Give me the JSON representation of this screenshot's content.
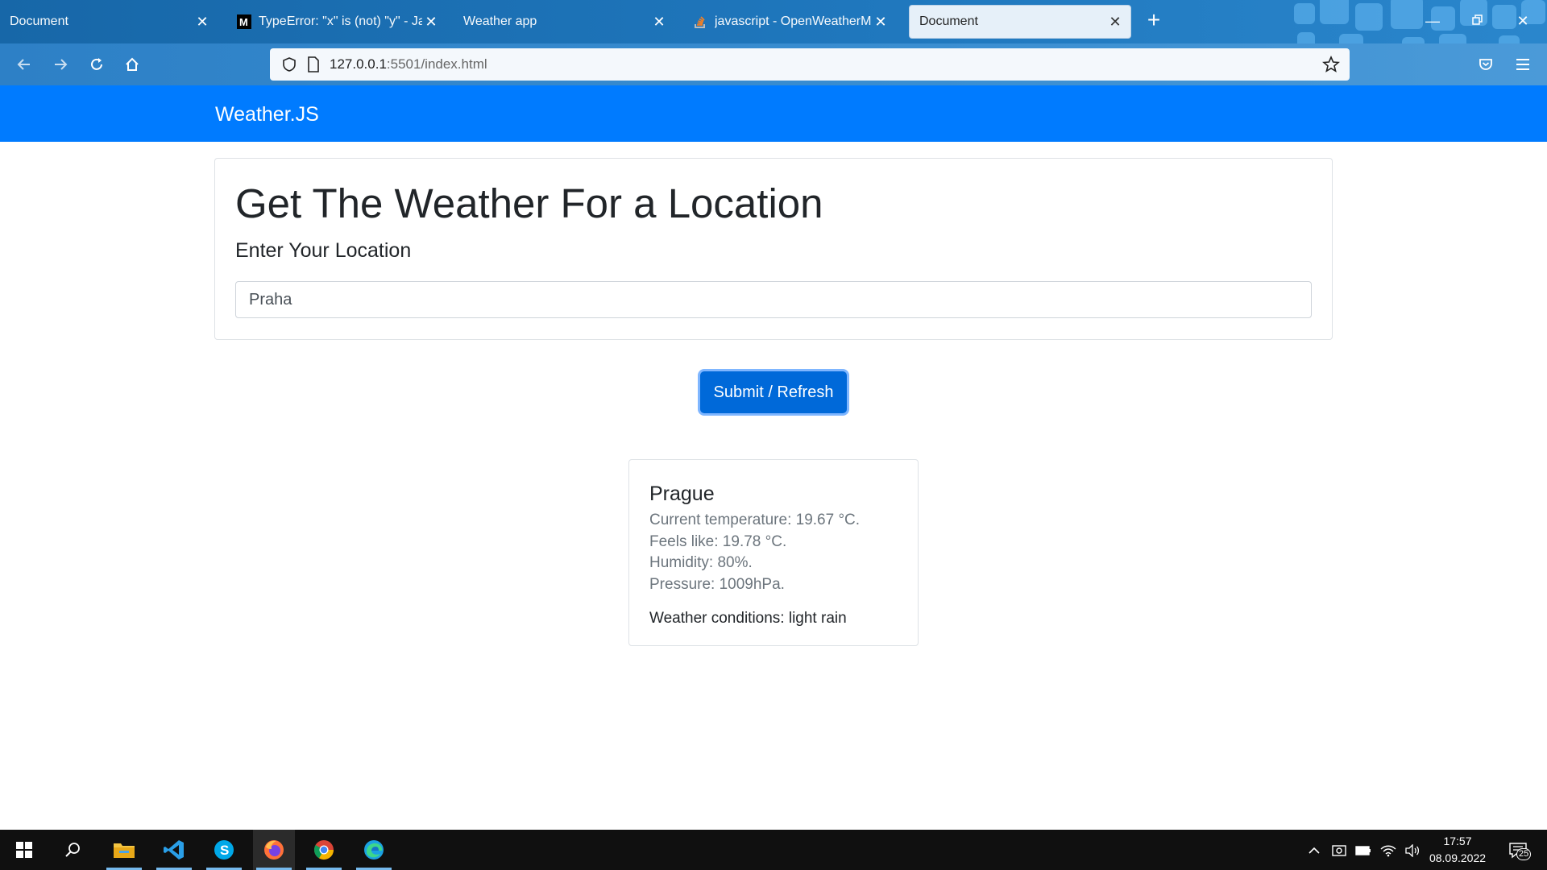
{
  "browser": {
    "tabs": [
      {
        "title": "Document",
        "active": false
      },
      {
        "title": "TypeError: \"x\" is (not) \"y\" - JavaS",
        "active": false
      },
      {
        "title": "Weather app",
        "active": false
      },
      {
        "title": "javascript - OpenWeatherMap A",
        "active": false
      },
      {
        "title": "Document",
        "active": true
      }
    ],
    "new_tab": "+",
    "url_host": "127.0.0.1",
    "url_rest": ":5501/index.html"
  },
  "site": {
    "brand": "Weather.JS",
    "heading": "Get The Weather For a Location",
    "lead": "Enter Your Location",
    "location_value": "Praha",
    "submit_label": "Submit / Refresh"
  },
  "weather": {
    "city": "Prague",
    "temperature": "Current temperature: 19.67 °C.",
    "feels_like": "Feels like: 19.78 °C.",
    "humidity": "Humidity: 80%.",
    "pressure": "Pressure: 1009hPa.",
    "conditions": "Weather conditions: light rain"
  },
  "taskbar": {
    "time": "17:57",
    "date": "08.09.2022",
    "notifications": "25",
    "apps": [
      "file-explorer",
      "vscode",
      "skype",
      "firefox",
      "chrome",
      "edge"
    ]
  },
  "colors": {
    "brand_blue": "#007bff",
    "button_blue": "#0069d9",
    "taskbar": "#101010"
  }
}
